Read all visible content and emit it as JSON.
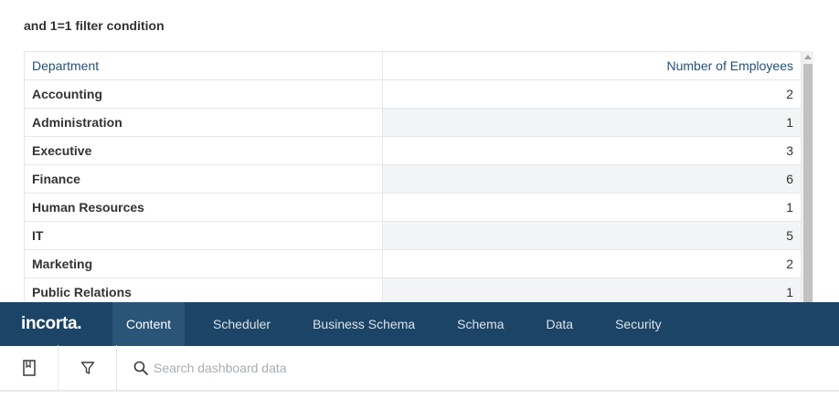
{
  "insight": {
    "title": "and 1=1 filter condition"
  },
  "table": {
    "headers": [
      "Department",
      "Number of Employees"
    ],
    "rows": [
      {
        "department": "Accounting",
        "count": "2"
      },
      {
        "department": "Administration",
        "count": "1"
      },
      {
        "department": "Executive",
        "count": "3"
      },
      {
        "department": "Finance",
        "count": "6"
      },
      {
        "department": "Human Resources",
        "count": "1"
      },
      {
        "department": "IT",
        "count": "5"
      },
      {
        "department": "Marketing",
        "count": "2"
      },
      {
        "department": "Public Relations",
        "count": "1"
      }
    ]
  },
  "nav": {
    "logo": "incorta.",
    "items": [
      "Content",
      "Scheduler",
      "Business Schema",
      "Schema",
      "Data",
      "Security"
    ],
    "active": "Content"
  },
  "toolbar": {
    "bookmark_icon": "bookmark-icon",
    "filter_icon": "filter-icon",
    "search_icon": "search-icon",
    "search_placeholder": "Search dashboard data"
  },
  "colors": {
    "navbar": "#1c4466",
    "nav_active": "#2b5578",
    "header_text": "#24507a",
    "alt_row": "#f3f4f5"
  }
}
